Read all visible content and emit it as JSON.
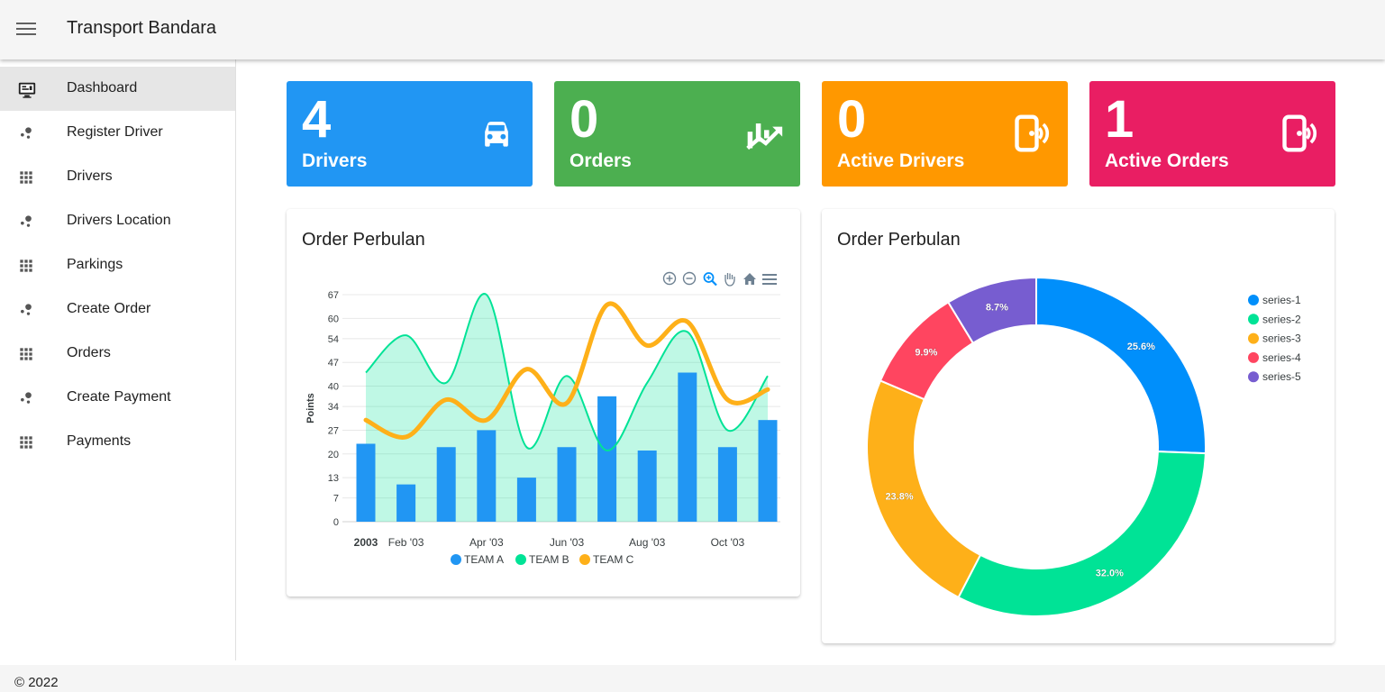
{
  "app": {
    "title": "Transport Bandara",
    "footer": "© 2022"
  },
  "sidebar": {
    "items": [
      {
        "label": "Dashboard",
        "icon": "monitor-icon",
        "active": true
      },
      {
        "label": "Register Driver",
        "icon": "bubbles-icon"
      },
      {
        "label": "Drivers",
        "icon": "grid-icon"
      },
      {
        "label": "Drivers Location",
        "icon": "bubbles-icon"
      },
      {
        "label": "Parkings",
        "icon": "grid-icon"
      },
      {
        "label": "Create Order",
        "icon": "bubbles-icon"
      },
      {
        "label": "Orders",
        "icon": "grid-icon"
      },
      {
        "label": "Create Payment",
        "icon": "bubbles-icon"
      },
      {
        "label": "Payments",
        "icon": "grid-icon"
      }
    ]
  },
  "stats": [
    {
      "value": "4",
      "label": "Drivers",
      "color": "#2196f3",
      "icon": "car-icon"
    },
    {
      "value": "0",
      "label": "Orders",
      "color": "#4caf50",
      "icon": "trending-chart-icon"
    },
    {
      "value": "0",
      "label": "Active Drivers",
      "color": "#ff9800",
      "icon": "phone-signal-icon"
    },
    {
      "value": "1",
      "label": "Active Orders",
      "color": "#e91e63",
      "icon": "phone-signal-icon"
    }
  ],
  "cards": {
    "combo_title": "Order Perbulan",
    "donut_title": "Order Perbulan"
  },
  "chart_data": [
    {
      "type": "bar",
      "title": "Order Perbulan",
      "ylabel": "Points",
      "xlabel": "",
      "ylim": [
        0,
        67
      ],
      "yticks": [
        0,
        7,
        13,
        20,
        27,
        34,
        40,
        47,
        54,
        60,
        67
      ],
      "x": [
        "01/01/2003",
        "02/01/2003",
        "03/01/2003",
        "04/01/2003",
        "05/01/2003",
        "06/01/2003",
        "07/01/2003",
        "08/01/2003",
        "09/01/2003",
        "10/01/2003",
        "11/01/2003"
      ],
      "xtick_labels": [
        {
          "x": "01/01/2003",
          "label": "2003",
          "bold": true
        },
        {
          "x": "02/01/2003",
          "label": "Feb '03"
        },
        {
          "x": "04/01/2003",
          "label": "Apr '03"
        },
        {
          "x": "06/01/2003",
          "label": "Jun '03"
        },
        {
          "x": "08/01/2003",
          "label": "Aug '03"
        },
        {
          "x": "10/01/2003",
          "label": "Oct '03"
        }
      ],
      "series": [
        {
          "name": "TEAM A",
          "type": "column",
          "color": "#2196f3",
          "values": [
            23,
            11,
            22,
            27,
            13,
            22,
            37,
            21,
            44,
            22,
            30
          ]
        },
        {
          "name": "TEAM B",
          "type": "area",
          "color": "#00e396",
          "values": [
            44,
            55,
            41,
            67,
            22,
            43,
            21,
            41,
            56,
            27,
            43
          ]
        },
        {
          "name": "TEAM C",
          "type": "line",
          "color": "#feb019",
          "values": [
            30,
            25,
            36,
            30,
            45,
            35,
            64,
            52,
            59,
            36,
            39
          ]
        }
      ],
      "legend_position": "bottom",
      "toolbar": [
        "zoom-in-icon",
        "zoom-out-icon",
        "selection-zoom-icon",
        "pan-hand-icon",
        "home-reset-icon",
        "menu-icon"
      ]
    },
    {
      "type": "pie",
      "subtype": "donut",
      "title": "Order Perbulan",
      "labels": [
        "series-1",
        "series-2",
        "series-3",
        "series-4",
        "series-5"
      ],
      "values": [
        25.6,
        32.0,
        23.8,
        9.9,
        8.7
      ],
      "data_labels": [
        "25.6%",
        "32.0%",
        "23.8%",
        "9.9%",
        "8.7%"
      ],
      "colors": [
        "#008ffb",
        "#00e396",
        "#feb019",
        "#ff4560",
        "#775dd0"
      ],
      "legend_position": "top-right"
    }
  ]
}
